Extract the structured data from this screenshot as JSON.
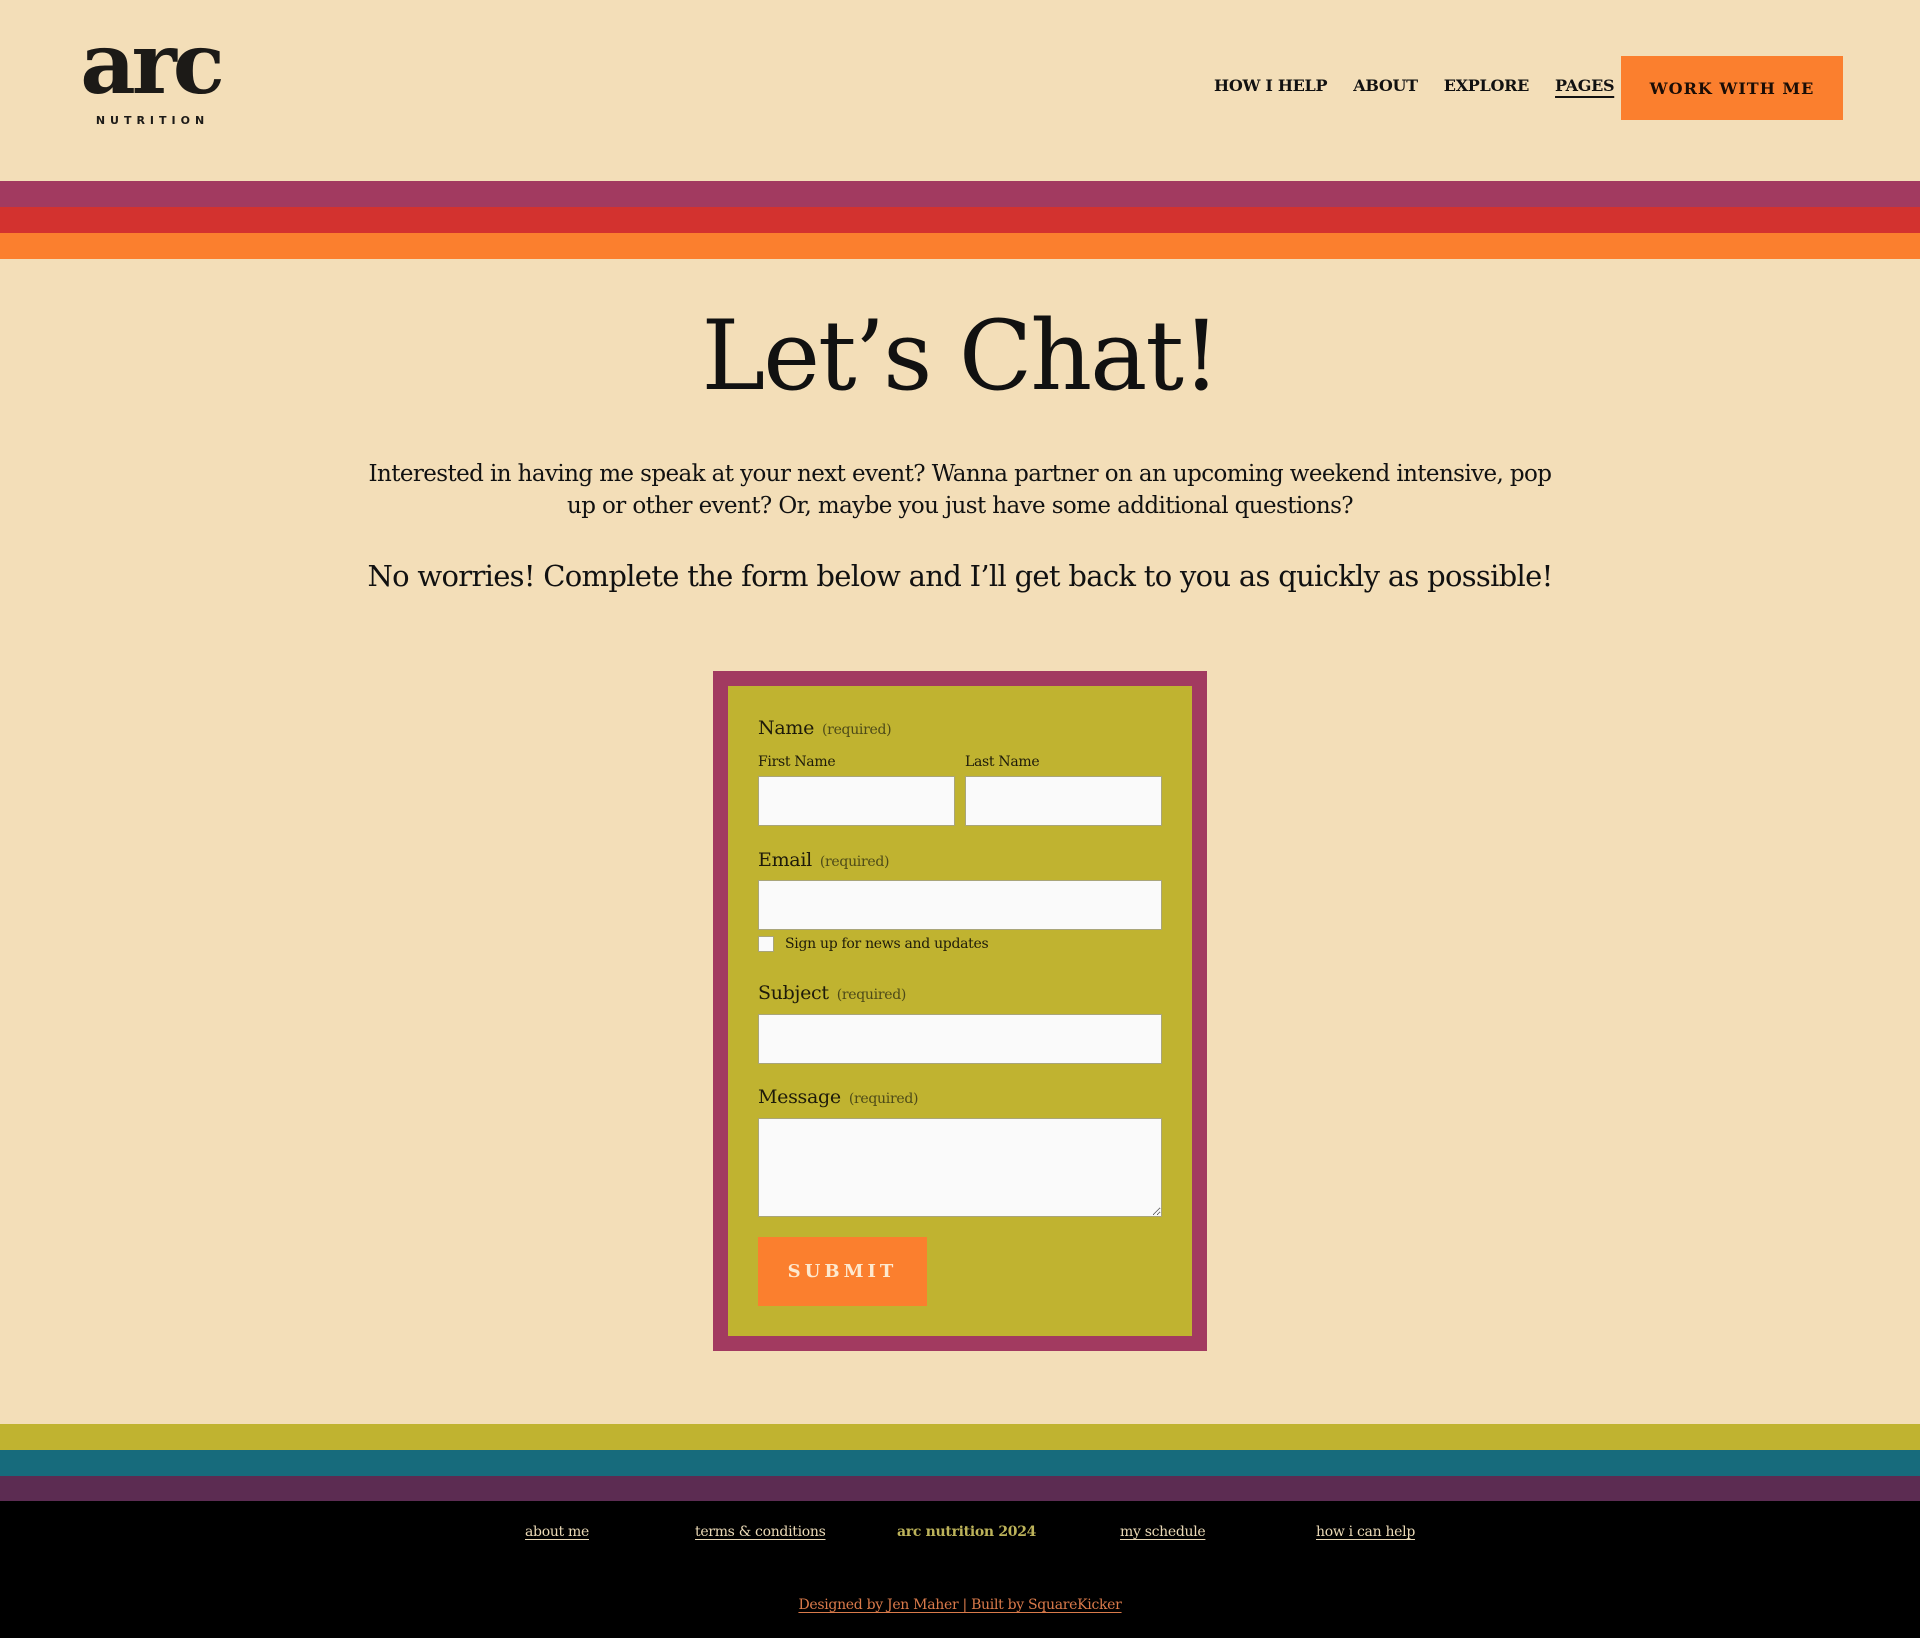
{
  "header": {
    "logo": {
      "word": "arc",
      "subtitle": "NUTRITION"
    },
    "nav": [
      {
        "label": "HOW I HELP",
        "active": false
      },
      {
        "label": "ABOUT",
        "active": false
      },
      {
        "label": "EXPLORE",
        "active": false
      },
      {
        "label": "PAGES",
        "active": true
      }
    ],
    "cta_label": "WORK WITH ME"
  },
  "colors": {
    "background": "#f3deb8",
    "accent_orange": "#fb7f2e",
    "top_stripes": [
      "#a23a60",
      "#d3322f",
      "#fb7f2e"
    ],
    "bottom_stripes": [
      "#c0b330",
      "#176b7c",
      "#5c2c52"
    ],
    "form_border": "#a23a60",
    "form_background": "#c0b330",
    "footer_background": "#000000"
  },
  "hero": {
    "title": "Let’s Chat!",
    "intro": "Interested in having me speak at your next event? Wanna partner on an upcoming weekend intensive, pop up or other event? Or, maybe you just have some additional questions?",
    "lead": "No worries! Complete the form below and I’ll get back to you as quickly as possible!"
  },
  "form": {
    "name": {
      "label": "Name",
      "required": "(required)",
      "first_label": "First Name",
      "first_value": "",
      "last_label": "Last Name",
      "last_value": ""
    },
    "email": {
      "label": "Email",
      "required": "(required)",
      "value": ""
    },
    "newsletter": {
      "label": "Sign up for news and updates",
      "checked": false
    },
    "subject": {
      "label": "Subject",
      "required": "(required)",
      "value": ""
    },
    "message": {
      "label": "Message",
      "required": "(required)",
      "value": ""
    },
    "submit_label": "SUBMIT"
  },
  "footer": {
    "links": [
      {
        "label": "about me"
      },
      {
        "label": "terms & conditions"
      },
      {
        "label": "arc nutrition 2024",
        "is_link": false
      },
      {
        "label": "my schedule"
      },
      {
        "label": "how i can help"
      }
    ],
    "credit": "Designed by Jen Maher | Built by SquareKicker"
  }
}
